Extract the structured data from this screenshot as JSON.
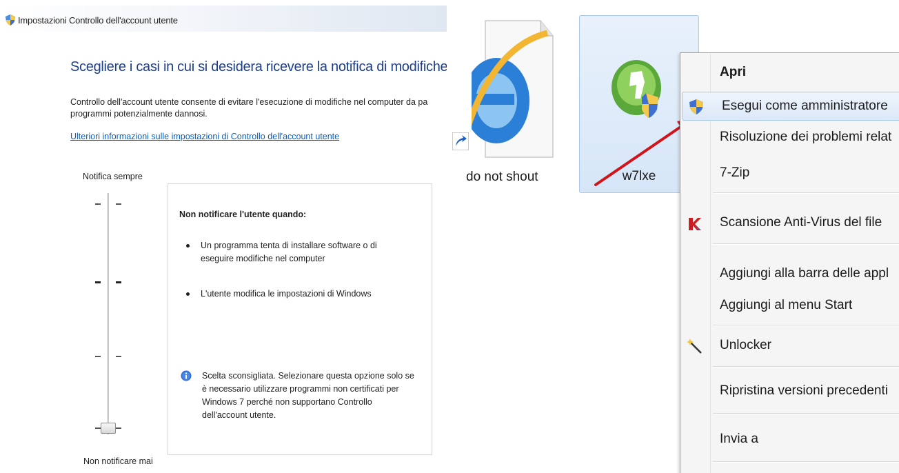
{
  "uac": {
    "window_title": "Impostazioni Controllo dell'account utente",
    "heading": "Scegliere i casi in cui si desidera ricevere la notifica di modifiche al comp",
    "description": "Controllo dell'account utente consente di evitare l'esecuzione di modifiche nel computer da pa programmi potenzialmente dannosi.",
    "link": "Ulteriori informazioni sulle impostazioni di Controllo dell'account utente",
    "slider_top_label": "Notifica sempre",
    "slider_bottom_label": "Non notificare mai",
    "slider_level": "4 of 4 (lowest)",
    "info_title": "Non notificare l'utente quando:",
    "bullets": [
      "Un programma tenta di installare software o di eseguire modifiche nel computer",
      "L'utente modifica le impostazioni di Windows"
    ],
    "note": "Scelta sconsigliata. Selezionare questa opzione solo se è necessario utilizzare programmi non certificati per Windows 7 perché non supportano Controllo dell'account utente."
  },
  "desktop": {
    "icons": [
      {
        "label": "do not shout",
        "icon": "internet-explorer-shortcut-icon"
      },
      {
        "label": "w7lxe",
        "icon": "w7lxe-app-icon",
        "selected": true
      }
    ]
  },
  "context_menu": {
    "items": [
      {
        "label": "Apri",
        "bold": true
      },
      {
        "label": "Esegui come amministratore",
        "icon": "uac-shield-icon",
        "highlighted": true
      },
      {
        "label": "Risoluzione dei problemi relat"
      },
      {
        "label": "7-Zip"
      },
      {
        "label": "Scansione Anti-Virus del file",
        "icon": "kaspersky-icon"
      },
      {
        "label": "Aggiungi alla barra delle appl"
      },
      {
        "label": "Aggiungi al menu Start"
      },
      {
        "label": "Unlocker",
        "icon": "unlocker-wand-icon"
      },
      {
        "label": "Ripristina versioni precedenti"
      },
      {
        "label": "Invia a"
      }
    ]
  },
  "colors": {
    "heading_blue": "#1e3e8a",
    "link_blue": "#0a5fb8",
    "arrow_red": "#d0141a",
    "selection_blue": "#d6e6f8"
  }
}
